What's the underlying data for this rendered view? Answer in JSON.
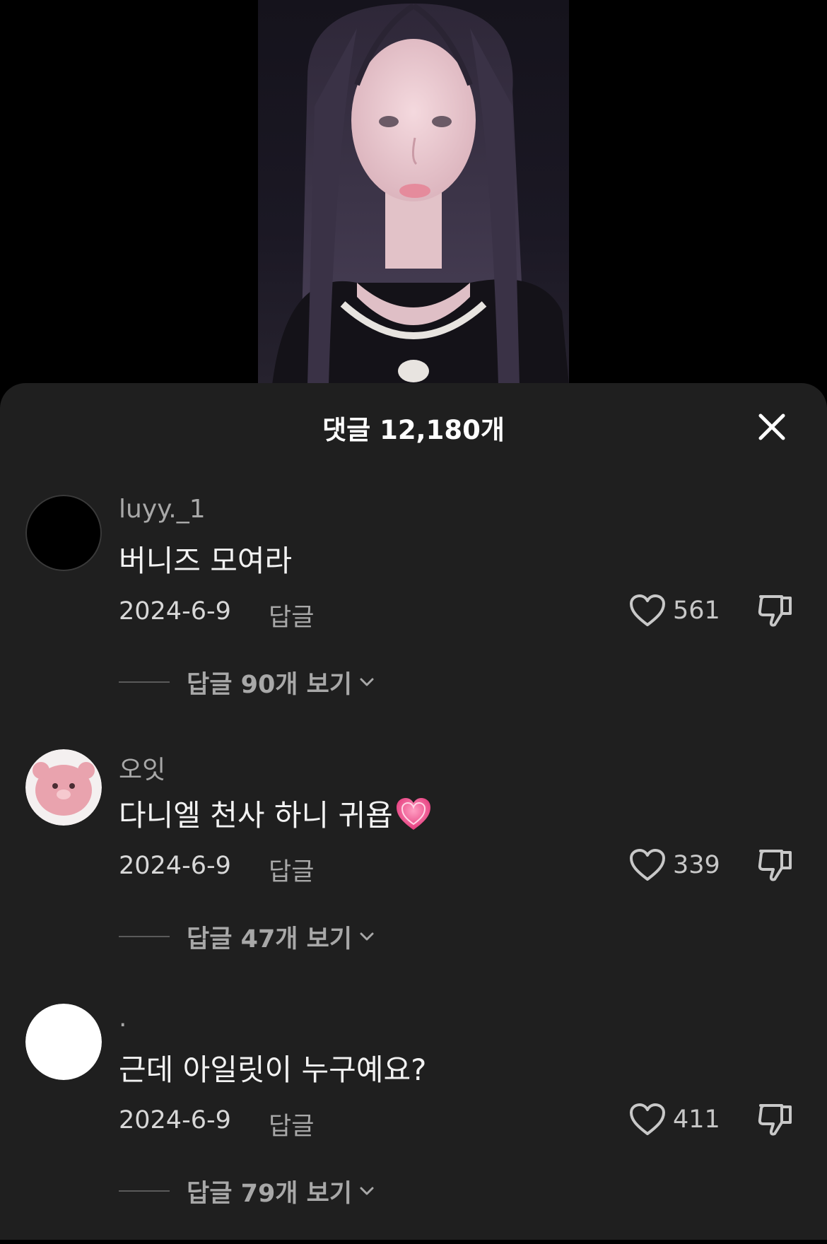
{
  "header": {
    "title": "댓글 12,180개"
  },
  "comments": [
    {
      "username": "luyy._1",
      "text": "버니즈 모여라",
      "date": "2024-6-9",
      "reply_label": "답글",
      "likes": "561",
      "view_replies": "답글 90개 보기",
      "avatar": "black-circle-avatar"
    },
    {
      "username": "오잇",
      "text": "다니엘 천사 하니 귀욥",
      "emoji": "pink-heart-emoji",
      "date": "2024-6-9",
      "reply_label": "답글",
      "likes": "339",
      "view_replies": "답글 47개 보기",
      "avatar": "pink-plush-avatar"
    },
    {
      "username": ".",
      "text": "근데 아일릿이 누구예요?",
      "date": "2024-6-9",
      "reply_label": "답글",
      "likes": "411",
      "view_replies": "답글 79개 보기",
      "avatar": "white-circle-avatar"
    }
  ],
  "colors": {
    "sheet_bg": "#1f1f1f",
    "text_primary": "#f2f2f2",
    "text_secondary": "#a8a8a8"
  }
}
